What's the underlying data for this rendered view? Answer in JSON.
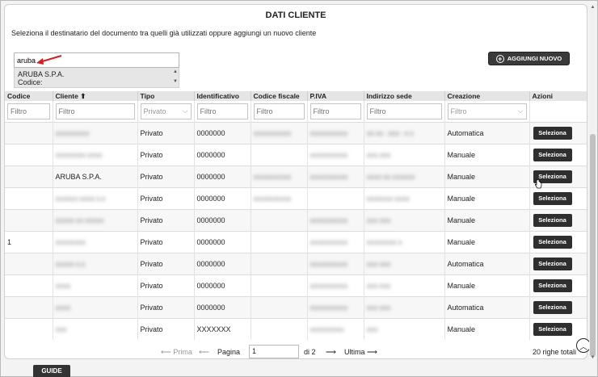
{
  "panel": {
    "title": "DATI CLIENTE",
    "subtitle": "Seleziona il destinatario del documento tra quelli già utilizzati oppure aggiungi un nuovo cliente"
  },
  "search": {
    "value": "aruba",
    "suggestion_line1": "ARUBA S.P.A.",
    "suggestion_line2": "Codice:"
  },
  "add_button": {
    "label": "AGGIUNGI NUOVO"
  },
  "table": {
    "headers": [
      "Codice",
      "Cliente ⬆",
      "Tipo",
      "Identificativo",
      "Codice fiscale",
      "P.IVA",
      "Indirizzo sede",
      "Creazione",
      "Azioni"
    ],
    "filters": {
      "placeholder": "Filtro",
      "tipo": "Privato",
      "creazione": "Filtro"
    },
    "rows": [
      {
        "codice": "",
        "cliente": "XXXXXXXXX",
        "tipo": "Privato",
        "id": "0000000",
        "cf": "XXXXXXXXXX",
        "piva": "XXXXXXXXXX",
        "sede": "XX XX - XXX - X X",
        "creazione": "Automatica",
        "action": "Seleziona"
      },
      {
        "codice": "",
        "cliente": "XXXXXXXX XXXX",
        "tipo": "Privato",
        "id": "0000000",
        "cf": "",
        "piva": "XXXXXXXXXX",
        "sede": "XXX XXX",
        "creazione": "Manuale",
        "action": "Seleziona"
      },
      {
        "codice": "",
        "cliente": "ARUBA S.P.A.",
        "tipo": "Privato",
        "id": "0000000",
        "cf": "XXXXXXXXXX",
        "piva": "XXXXXXXXXX",
        "sede": "XXXX XX XXXXXX",
        "creazione": "Manuale",
        "action": "Seleziona"
      },
      {
        "codice": "",
        "cliente": "XXXXXX XXXX X.X",
        "tipo": "Privato",
        "id": "0000000",
        "cf": "XXXXXXXXXX",
        "piva": "",
        "sede": "XXXXXXX XXXX",
        "creazione": "Manuale",
        "action": "Seleziona"
      },
      {
        "codice": "",
        "cliente": "XXXXX XX XXXXX",
        "tipo": "Privato",
        "id": "0000000",
        "cf": "",
        "piva": "XXXXXXXXXX",
        "sede": "XXX XXX",
        "creazione": "Manuale",
        "action": "Seleziona"
      },
      {
        "codice": "1",
        "cliente": "XXXXXXXX",
        "tipo": "Privato",
        "id": "0000000",
        "cf": "",
        "piva": "XXXXXXXXXX",
        "sede": "XXXXXXXX X",
        "creazione": "Manuale",
        "action": "Seleziona"
      },
      {
        "codice": "",
        "cliente": "XXXXX X.X.",
        "tipo": "Privato",
        "id": "0000000",
        "cf": "",
        "piva": "XXXXXXXXXX",
        "sede": "XXX XXX",
        "creazione": "Automatica",
        "action": "Seleziona"
      },
      {
        "codice": "",
        "cliente": "XXXX",
        "tipo": "Privato",
        "id": "0000000",
        "cf": "",
        "piva": "XXXXXXXXXX",
        "sede": "XXX XXX",
        "creazione": "Manuale",
        "action": "Seleziona"
      },
      {
        "codice": "",
        "cliente": "XXXX",
        "tipo": "Privato",
        "id": "0000000",
        "cf": "",
        "piva": "XXXXXXXXXX",
        "sede": "XXX XXX",
        "creazione": "Automatica",
        "action": "Seleziona"
      },
      {
        "codice": "",
        "cliente": "XXX",
        "tipo": "Privato",
        "id": "XXXXXXX",
        "cf": "",
        "piva": "XXXXXXXXX",
        "sede": "XXX",
        "creazione": "Manuale",
        "action": "Seleziona"
      }
    ]
  },
  "pager": {
    "first": "⟵ Prima",
    "prev": "⟵",
    "page_label": "Pagina",
    "page_value": "1",
    "of": "di 2",
    "next": "⟶",
    "last": "Ultima ⟶",
    "total": "20 righe totali"
  },
  "guide": {
    "label": "GUIDE"
  },
  "colors": {
    "accent_arrow": "#d42020",
    "button_dark": "#2f2f2f"
  }
}
